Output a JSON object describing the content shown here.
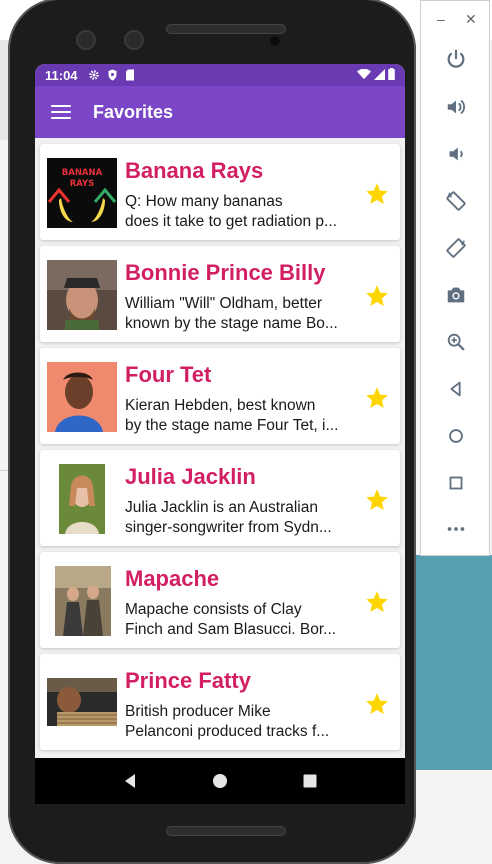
{
  "status_bar": {
    "time": "11:04"
  },
  "app_bar": {
    "title": "Favorites"
  },
  "colors": {
    "status_bar": "#6a3ab2",
    "app_bar": "#7b46c7",
    "artist_name": "#d21f63",
    "star": "#ffd500"
  },
  "favorites": [
    {
      "name": "Banana Rays",
      "desc_line1": "Q: How many bananas",
      "desc_line2": "does it take to get radiation p...",
      "thumb_text": "BANANA RAYS",
      "starred": true
    },
    {
      "name": "Bonnie Prince Billy",
      "desc_line1": "William \"Will\" Oldham, better",
      "desc_line2": "known by the stage name Bo...",
      "starred": true
    },
    {
      "name": "Four Tet",
      "desc_line1": "Kieran Hebden, best known",
      "desc_line2": "by the stage name Four Tet, i...",
      "starred": true
    },
    {
      "name": "Julia Jacklin",
      "desc_line1": "Julia Jacklin is an Australian",
      "desc_line2": "singer-songwriter from Sydn...",
      "starred": true
    },
    {
      "name": "Mapache",
      "desc_line1": "Mapache consists of Clay",
      "desc_line2": "Finch and Sam Blasucci. Bor...",
      "starred": true
    },
    {
      "name": "Prince Fatty",
      "desc_line1": "British producer Mike",
      "desc_line2": "Pelanconi produced tracks f...",
      "starred": true
    }
  ],
  "side_toolbar": {
    "window_controls": [
      "minimize-icon",
      "close-icon"
    ],
    "tools": [
      "power-icon",
      "volume-up-icon",
      "volume-down-icon",
      "rotate-left-icon",
      "rotate-right-icon",
      "camera-icon",
      "zoom-icon",
      "back-icon",
      "home-icon",
      "overview-icon",
      "more-icon"
    ]
  },
  "nav_bar": {
    "buttons": [
      "back-icon",
      "home-icon",
      "recents-icon"
    ]
  }
}
